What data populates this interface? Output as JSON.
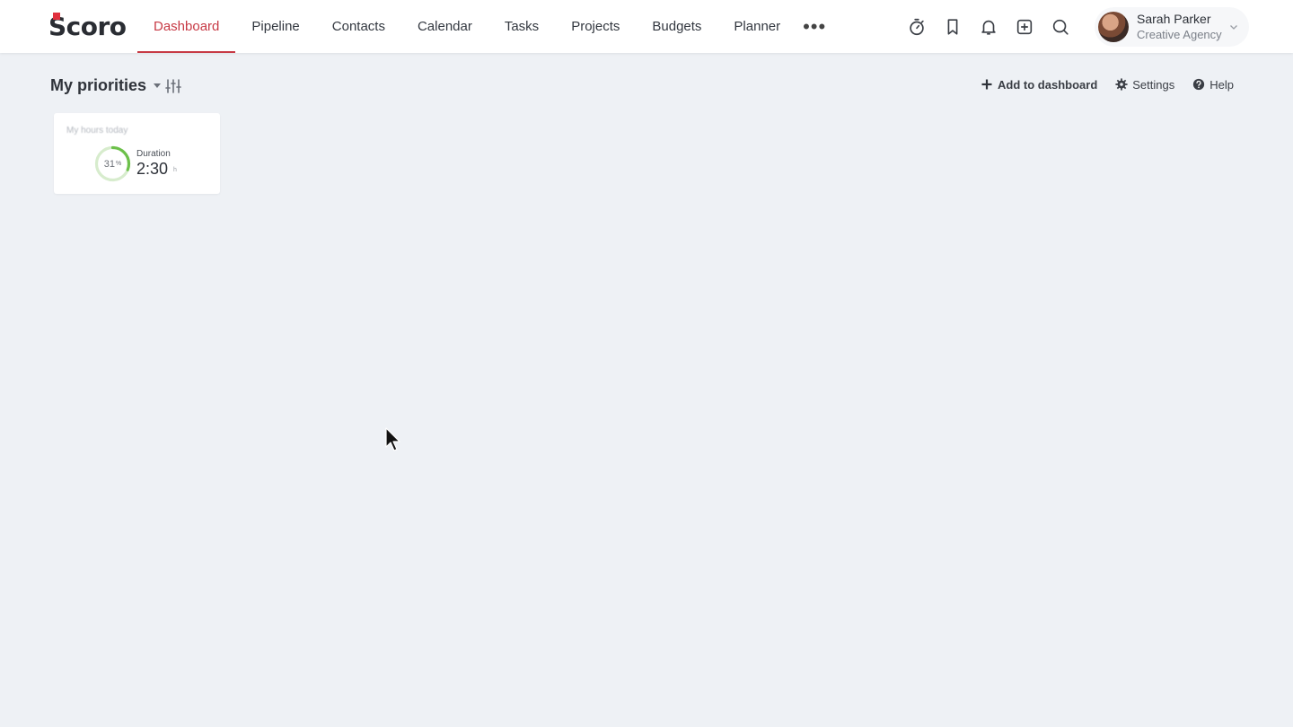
{
  "brand": {
    "logo_text": "Scoro",
    "accent": "#c73a45",
    "logo_mark_color": "#e0303e"
  },
  "nav": {
    "items": [
      {
        "label": "Dashboard",
        "active": true
      },
      {
        "label": "Pipeline"
      },
      {
        "label": "Contacts"
      },
      {
        "label": "Calendar"
      },
      {
        "label": "Tasks"
      },
      {
        "label": "Projects"
      },
      {
        "label": "Budgets"
      },
      {
        "label": "Planner"
      }
    ],
    "more_label": "•••"
  },
  "toolbar_icons": [
    "timer-icon",
    "bookmark-icon",
    "bell-icon",
    "add-icon",
    "search-icon"
  ],
  "user": {
    "name": "Sarah Parker",
    "company": "Creative Agency"
  },
  "page": {
    "title": "My priorities",
    "actions": {
      "add_label": "Add to dashboard",
      "settings_label": "Settings",
      "help_label": "Help"
    }
  },
  "widget": {
    "title": "My hours today",
    "percent": 31,
    "percent_text": "31",
    "percent_unit": "%",
    "duration_label": "Duration",
    "duration_value": "2:30",
    "duration_unit": "h",
    "gauge_color": "#6cc04a",
    "gauge_track": "#d7eccd"
  }
}
